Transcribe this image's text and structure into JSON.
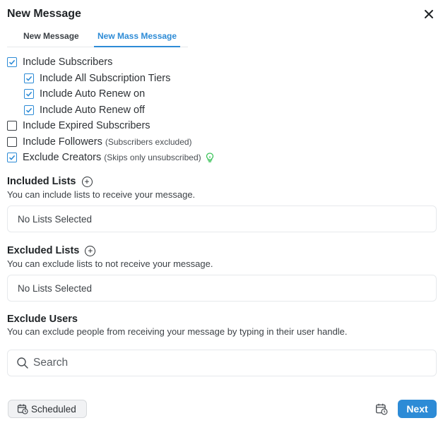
{
  "dialog": {
    "title": "New Message"
  },
  "tabs": [
    {
      "label": "New Message",
      "active": false
    },
    {
      "label": "New Mass Message",
      "active": true
    }
  ],
  "options": {
    "include_subscribers": {
      "label": "Include Subscribers",
      "checked": true
    },
    "all_tiers": {
      "label": "Include All Subscription Tiers",
      "checked": true
    },
    "auto_renew_on": {
      "label": "Include Auto Renew on",
      "checked": true
    },
    "auto_renew_off": {
      "label": "Include Auto Renew off",
      "checked": true
    },
    "expired": {
      "label": "Include Expired Subscribers",
      "checked": false
    },
    "followers": {
      "label": "Include Followers",
      "note": "(Subscribers excluded)",
      "checked": false
    },
    "exclude_creators": {
      "label": "Exclude Creators",
      "note": "(Skips only unsubscribed)",
      "checked": true
    }
  },
  "included_lists": {
    "title": "Included Lists",
    "description": "You can include lists to receive your message.",
    "empty_text": "No Lists Selected"
  },
  "excluded_lists": {
    "title": "Excluded Lists",
    "description": "You can exclude lists to not receive your message.",
    "empty_text": "No Lists Selected"
  },
  "exclude_users": {
    "title": "Exclude Users",
    "description": "You can exclude people from receiving your message by typing in their user handle.",
    "search_placeholder": "Search",
    "search_value": ""
  },
  "footer": {
    "scheduled_label": "Scheduled",
    "next_label": "Next"
  },
  "colors": {
    "accent": "#2d8bd6",
    "bulb": "#3cc35a"
  }
}
